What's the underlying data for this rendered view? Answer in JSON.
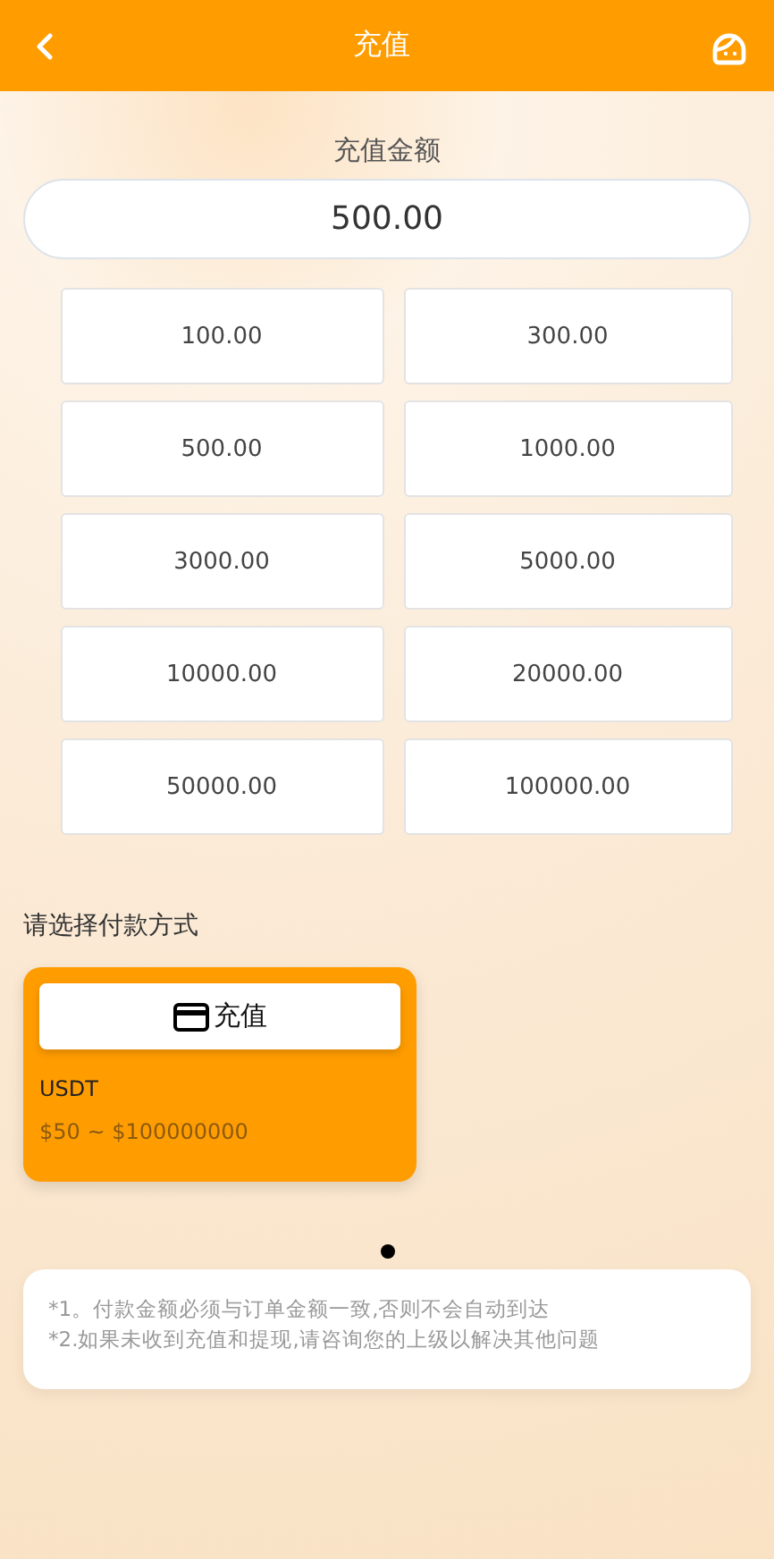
{
  "header": {
    "title": "充值"
  },
  "amount": {
    "label": "充值金额",
    "value": "500.00"
  },
  "presets": [
    "100.00",
    "300.00",
    "500.00",
    "1000.00",
    "3000.00",
    "5000.00",
    "10000.00",
    "20000.00",
    "50000.00",
    "100000.00"
  ],
  "payment": {
    "label": "请选择付款方式",
    "methods": [
      {
        "button": "充值",
        "name": "USDT",
        "range": "$50 ~ $100000000"
      }
    ]
  },
  "notes": [
    "*1。付款金额必须与订单金额一致,否则不会自动到达",
    "*2.如果未收到充值和提现,请咨询您的上级以解决其他问题"
  ]
}
